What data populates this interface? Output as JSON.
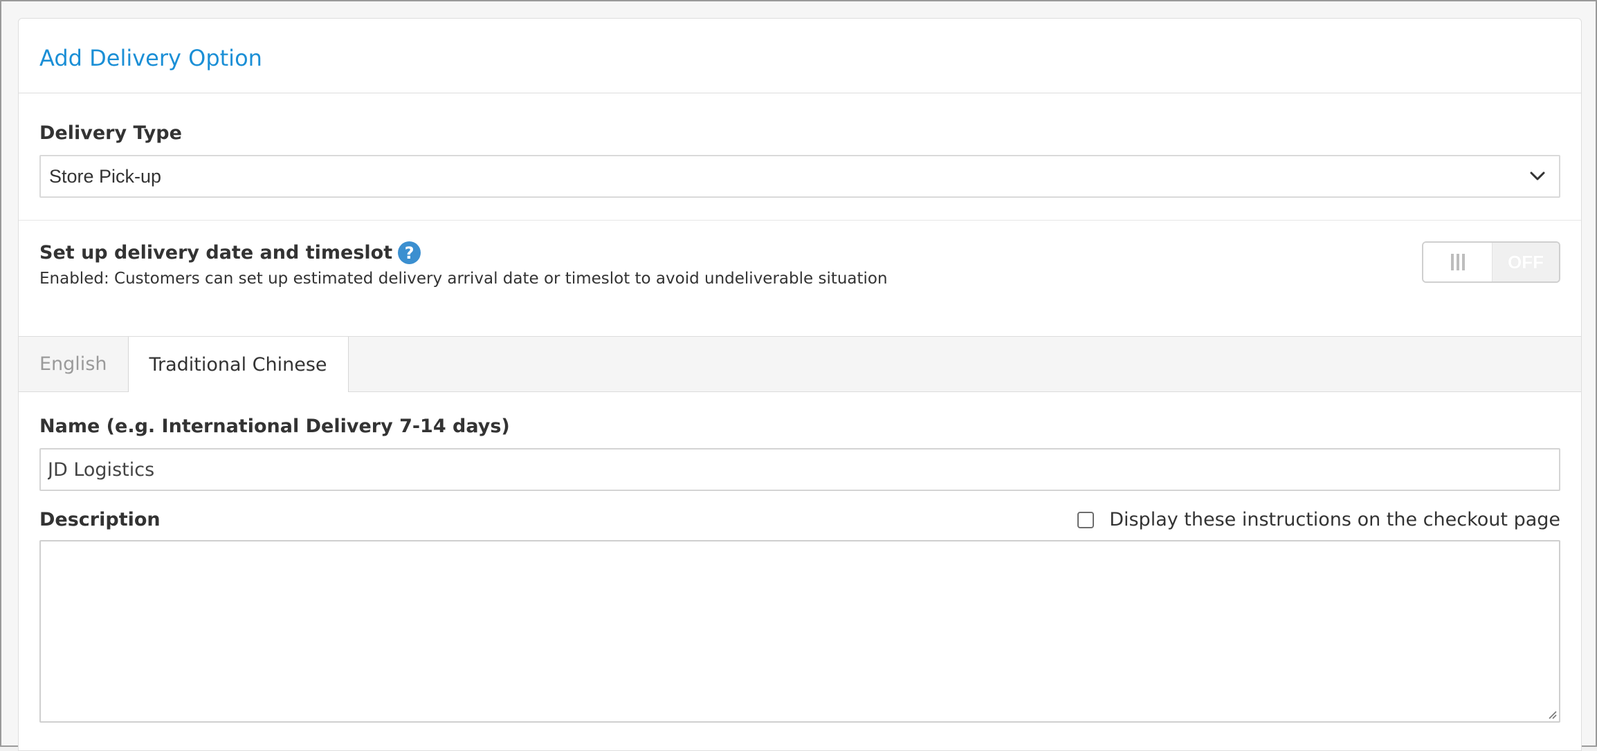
{
  "panel": {
    "title": "Add Delivery Option"
  },
  "delivery_type": {
    "label": "Delivery Type",
    "selected": "Store Pick-up",
    "icon": "chevron-down-icon"
  },
  "timeslot": {
    "title": "Set up delivery date and timeslot",
    "help_icon": "?",
    "description": "Enabled: Customers can set up estimated delivery arrival date or timeslot to avoid undeliverable situation",
    "toggle_state": "OFF"
  },
  "tabs": [
    {
      "label": "English",
      "active": false
    },
    {
      "label": "Traditional Chinese",
      "active": true
    }
  ],
  "form": {
    "name_label": "Name (e.g. International Delivery 7-14 days)",
    "name_value": "JD Logistics",
    "description_label": "Description",
    "checkbox_label": "Display these instructions on the checkout page",
    "checkbox_checked": false,
    "description_value": ""
  },
  "colors": {
    "accent": "#1b8fd6",
    "help_icon": "#3b8fd0"
  }
}
